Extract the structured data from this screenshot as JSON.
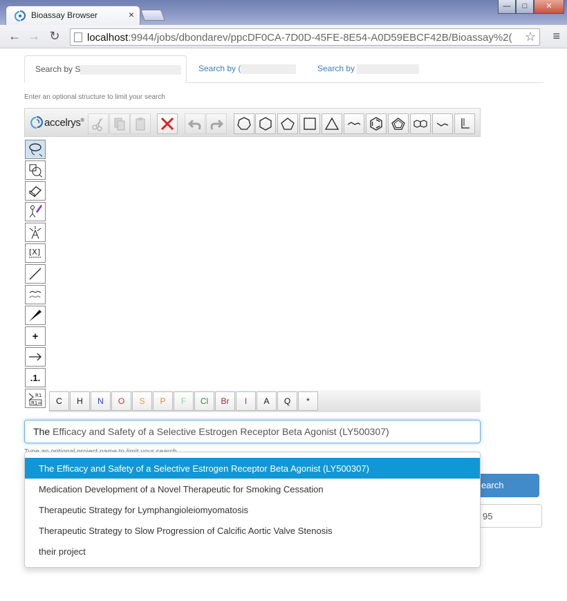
{
  "browser": {
    "tab_title": "Bioassay Browser",
    "tab_close": "×",
    "url_host": "localhost",
    "url_rest": ":9944/jobs/dbondarev/ppcDF0CA-7D0D-45FE-8E54-A0D59EBCF42B/Bioassay%2(",
    "window_minimize": "—",
    "window_maximize": "□",
    "window_close": "✕",
    "back": "←",
    "forward": "→",
    "reload": "↻",
    "star": "☆",
    "menu": "≡"
  },
  "page": {
    "tabs": [
      {
        "label": "Search by S"
      },
      {
        "label": "Search by ("
      },
      {
        "label": "Search by"
      }
    ],
    "structure_hint": "Enter an optional structure to limit your search",
    "project_hint": "Type an optional project name to limit your search",
    "project_input": {
      "typed": "The ",
      "completion": "Efficacy and Safety of a Selective Estrogen Receptor Beta Agonist (LY500307)"
    },
    "search_button": "earch",
    "count_value": "95"
  },
  "sketcher": {
    "brand": "accelrys",
    "brand_mark": "®",
    "atoms": [
      "C",
      "H",
      "N",
      "O",
      "S",
      "P",
      "F",
      "Cl",
      "Br",
      "I",
      "A",
      "Q",
      "*"
    ],
    "atom_colors": {
      "C": "#111111",
      "H": "#111111",
      "N": "#2b3bd1",
      "O": "#d42b2b",
      "S": "#d8a23a",
      "P": "#e8833a",
      "F": "#8fd48f",
      "Cl": "#2c8a2c",
      "Br": "#a02a2a",
      "I": "#8b2a8b",
      "A": "#111111",
      "Q": "#111111",
      "*": "#111111"
    },
    "left_text_tools": {
      "plus": "+",
      "chain_label": ".1.",
      "rgroup_top": "R1",
      "rgroup_bottom": "R1="
    }
  },
  "dropdown": {
    "items": [
      {
        "lead": "The ",
        "rest": "Efficacy and Safety of a Selective Estrogen Receptor Beta Agonist (LY500307)",
        "active": true
      },
      {
        "lead": "",
        "rest": "Medication Development of a Novel Therapeutic for Smoking Cessation",
        "active": false
      },
      {
        "lead": "",
        "rest": "Therapeutic Strategy for Lymphangioleiomyomatosis",
        "active": false
      },
      {
        "lead": "",
        "rest": "Therapeutic Strategy to Slow Progression of Calcific Aortic Valve Stenosis",
        "active": false
      },
      {
        "lead": "",
        "rest": "their project",
        "active": false
      }
    ]
  }
}
